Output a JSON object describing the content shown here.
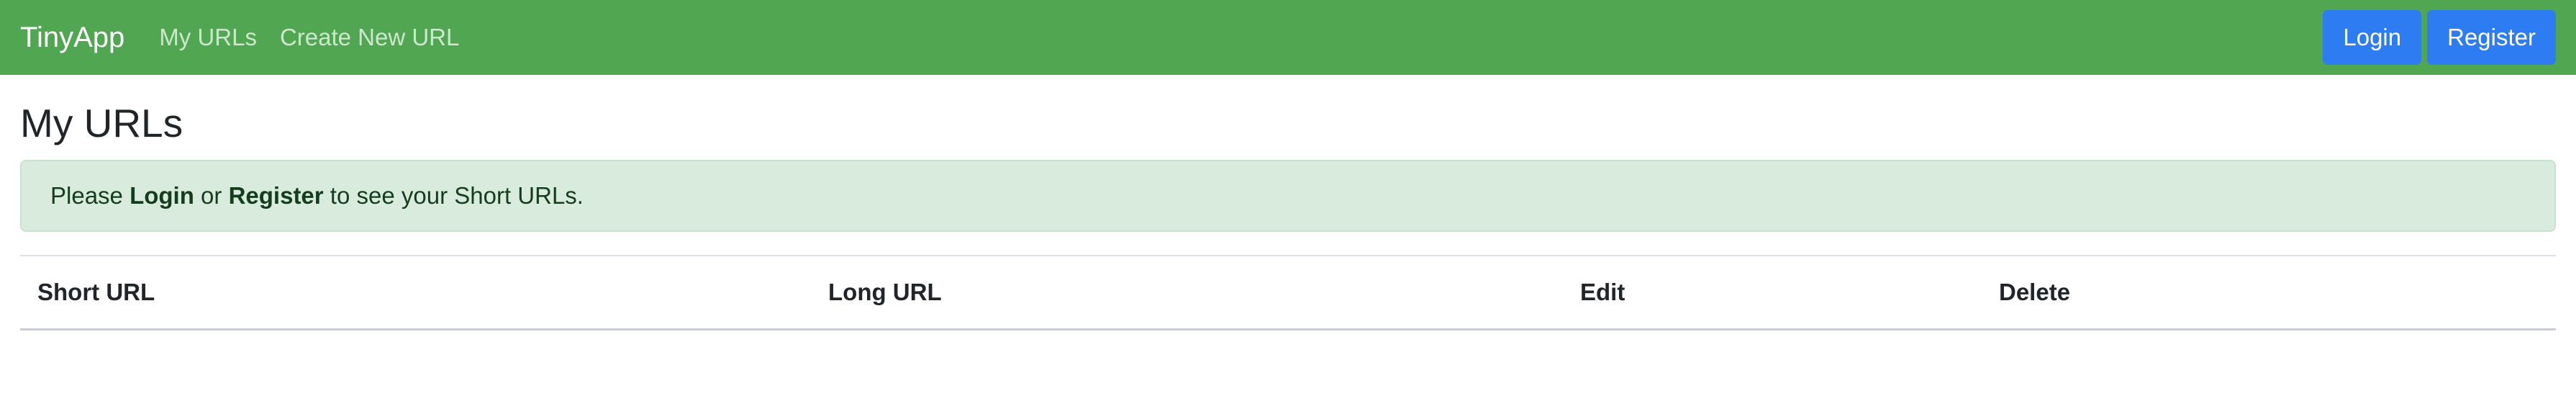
{
  "navbar": {
    "brand": "TinyApp",
    "links": [
      "My URLs",
      "Create New URL"
    ],
    "login_label": "Login",
    "register_label": "Register",
    "color": "#51a651",
    "button_color": "#2d7cf2"
  },
  "page": {
    "title": "My URLs"
  },
  "alert": {
    "prefix": "Please ",
    "login": "Login",
    "middle": " or ",
    "register": "Register",
    "suffix": " to see your Short URLs.",
    "bg_color": "#d9ebdd"
  },
  "table": {
    "headers": [
      "Short URL",
      "Long URL",
      "Edit",
      "Delete"
    ]
  }
}
